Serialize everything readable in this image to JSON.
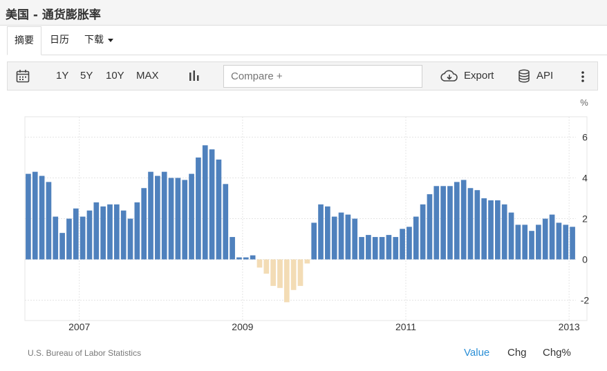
{
  "page": {
    "title": "美国 - 通货膨胀率"
  },
  "tabs": [
    {
      "label": "摘要",
      "active": true
    },
    {
      "label": "日历"
    },
    {
      "label": "下载",
      "dropdown": true
    }
  ],
  "toolbar": {
    "calendar_icon": "calendar-icon",
    "ranges": [
      "1Y",
      "5Y",
      "10Y",
      "MAX"
    ],
    "chart_type_icon": "bar-chart-icon",
    "compare_placeholder": "Compare +",
    "export_label": "Export",
    "api_label": "API",
    "more_icon": "vertical-ellipsis-icon"
  },
  "footer": {
    "source": "U.S. Bureau of Labor Statistics",
    "modes": [
      "Value",
      "Chg",
      "Chg%"
    ],
    "active_mode": "Value"
  },
  "colors": {
    "positive": "#4f81bd",
    "negative": "#f3dcb5",
    "active_mode": "#2b8fd6"
  },
  "chart_data": {
    "type": "bar",
    "unit_label": "%",
    "x_start": "2006-05",
    "x_labels": [
      "2007",
      "2009",
      "2011",
      "2013"
    ],
    "y_ticks": [
      6,
      4,
      2,
      0,
      -2
    ],
    "ylim": [
      -3,
      7
    ],
    "y_axis_position": "right",
    "grid": true,
    "values": [
      4.2,
      4.3,
      4.1,
      3.8,
      2.1,
      1.3,
      2.0,
      2.5,
      2.1,
      2.4,
      2.8,
      2.6,
      2.7,
      2.7,
      2.4,
      2.0,
      2.8,
      3.5,
      4.3,
      4.1,
      4.3,
      4.0,
      4.0,
      3.9,
      4.2,
      5.0,
      5.6,
      5.4,
      4.9,
      3.7,
      1.1,
      0.1,
      0.1,
      0.2,
      -0.4,
      -0.7,
      -1.3,
      -1.4,
      -2.1,
      -1.5,
      -1.3,
      -0.2,
      1.8,
      2.7,
      2.6,
      2.1,
      2.3,
      2.2,
      2.0,
      1.1,
      1.2,
      1.1,
      1.1,
      1.2,
      1.1,
      1.5,
      1.6,
      2.1,
      2.7,
      3.2,
      3.6,
      3.6,
      3.6,
      3.8,
      3.9,
      3.5,
      3.4,
      3.0,
      2.9,
      2.9,
      2.7,
      2.3,
      1.7,
      1.7,
      1.4,
      1.7,
      2.0,
      2.2,
      1.8,
      1.7,
      1.6
    ]
  }
}
